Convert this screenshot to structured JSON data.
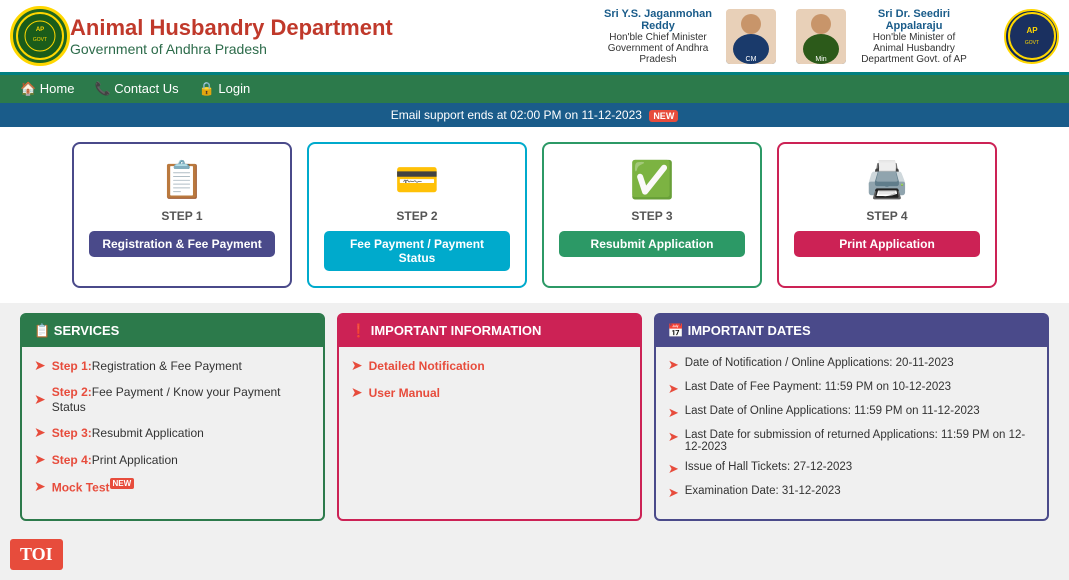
{
  "header": {
    "logo_text": "AP Govt",
    "title": "Animal Husbandry Department",
    "subtitle": "Government of Andhra Pradesh",
    "official1": {
      "name": "Sri Y.S. Jaganmohan Reddy",
      "role": "Hon'ble Chief Minister",
      "dept": "Government of Andhra Pradesh"
    },
    "official2": {
      "name": "Sri Dr. Seediri Appalaraju",
      "role": "Hon'ble Minister of",
      "dept": "Animal Husbandry Department Govt. of AP"
    },
    "emblem_text": "AP"
  },
  "nav": {
    "home": "🏠 Home",
    "contact": "📞 Contact Us",
    "login": "🔒 Login"
  },
  "alert": {
    "text": "Email support ends at 02:00 PM on 11-12-2023",
    "badge": "NEW"
  },
  "steps": [
    {
      "label": "STEP 1",
      "icon": "📋",
      "btn": "Registration & Fee Payment",
      "color_class": "1"
    },
    {
      "label": "STEP 2",
      "icon": "💳",
      "btn": "Fee Payment / Payment Status",
      "color_class": "2"
    },
    {
      "label": "STEP 3",
      "icon": "✅",
      "btn": "Resubmit Application",
      "color_class": "3"
    },
    {
      "label": "STEP 4",
      "icon": "🖨️",
      "btn": "Print Application",
      "color_class": "4"
    }
  ],
  "services": {
    "header": "📋 SERVICES",
    "items": [
      {
        "link": "Step 1:",
        "text": "Registration & Fee Payment"
      },
      {
        "link": "Step 2:",
        "text": "Fee Payment / Know your Payment Status"
      },
      {
        "link": "Step 3:",
        "text": "Resubmit Application"
      },
      {
        "link": "Step 4:",
        "text": "Print Application"
      },
      {
        "link": "Mock Test",
        "text": "",
        "new": true
      }
    ]
  },
  "important_info": {
    "header": "❗ IMPORTANT INFORMATION",
    "items": [
      "Detailed Notification",
      "User Manual"
    ]
  },
  "important_dates": {
    "header": "📅 IMPORTANT DATES",
    "items": [
      "Date of Notification / Online Applications: 20-11-2023",
      "Last Date of Fee Payment: 11:59 PM on 10-12-2023",
      "Last Date of Online Applications: 11:59 PM on 11-12-2023",
      "Last Date for submission of returned Applications: 11:59 PM on 12-12-2023",
      "Issue of Hall Tickets: 27-12-2023",
      "Examination Date: 31-12-2023"
    ]
  },
  "toi": "TOI"
}
